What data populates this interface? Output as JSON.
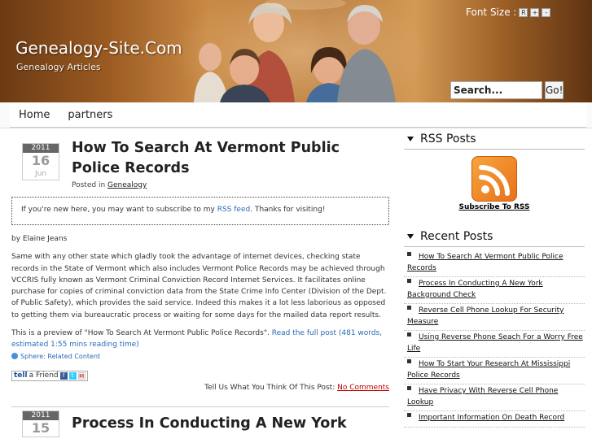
{
  "header": {
    "site_title": "Genealogy-Site.Com",
    "site_description": "Genealogy Articles",
    "font_size_label": "Font Size :",
    "font_size_buttons": [
      "R",
      "+",
      "-"
    ],
    "search": {
      "value": "Search...",
      "button_label": "Go!"
    }
  },
  "nav": {
    "items": [
      {
        "label": "Home"
      },
      {
        "label": "partners"
      }
    ]
  },
  "posts": [
    {
      "date": {
        "year": "2011",
        "day": "16",
        "month": "Jun"
      },
      "title": "How To Search At Vermont Public Police Records",
      "posted_in_label": "Posted in",
      "category": "Genealogy",
      "notice_before": "If you're new here, you may want to subscribe to my",
      "notice_link": "RSS feed",
      "notice_after": ". Thanks for visiting!",
      "author": "by Elaine Jeans",
      "body": "Same with any other state which gladly took the advantage of internet devices, checking state records in the State of Vermont which also includes Vermont Police Records may be achieved through VCCRIS fully known as Vermont Criminal Conviction Record Internet Services. It facilitates online purchase for copies of criminal conviction data from the State Crime Info Center (Division of the Dept. of Public Safety), which provides the said service. Indeed this makes it a lot less laborious as opposed to getting them via bureaucratic process or waiting for some days for the mailed data report results.",
      "preview_text": "This is a preview of \"How To Search At Vermont Public Police Records\".",
      "read_more": "Read the full post (481 words, estimated 1:55 mins reading time)",
      "sphere_label": "Sphere: Related Content",
      "share_label": "a Friend",
      "share_tell": "tell",
      "comments_prompt": "Tell Us What You Think Of This Post:",
      "comments_link": "No Comments"
    },
    {
      "date": {
        "year": "2011",
        "day": "15",
        "month": ""
      },
      "title": "Process In Conducting A New York"
    }
  ],
  "sidebar": {
    "rss_title": "RSS Posts",
    "rss_subscribe": "Subscribe To RSS",
    "recent_title": "Recent Posts",
    "recent_posts": [
      "How To Search At Vermont Public Police Records",
      "Process In Conducting A New York Background Check",
      "Reverse Cell Phone Lookup For Security Measure",
      "Using Reverse Phone Seach For a Worry Free Life",
      "How To Start Your Research At Mississippi Police Records",
      "Have Privacy With Reverse Cell Phone Lookup",
      "Important Information On Death Record"
    ]
  },
  "colors": {
    "link": "#2a6ab8",
    "comments_link": "#bb0000",
    "rss_orange": "#e8701a"
  }
}
